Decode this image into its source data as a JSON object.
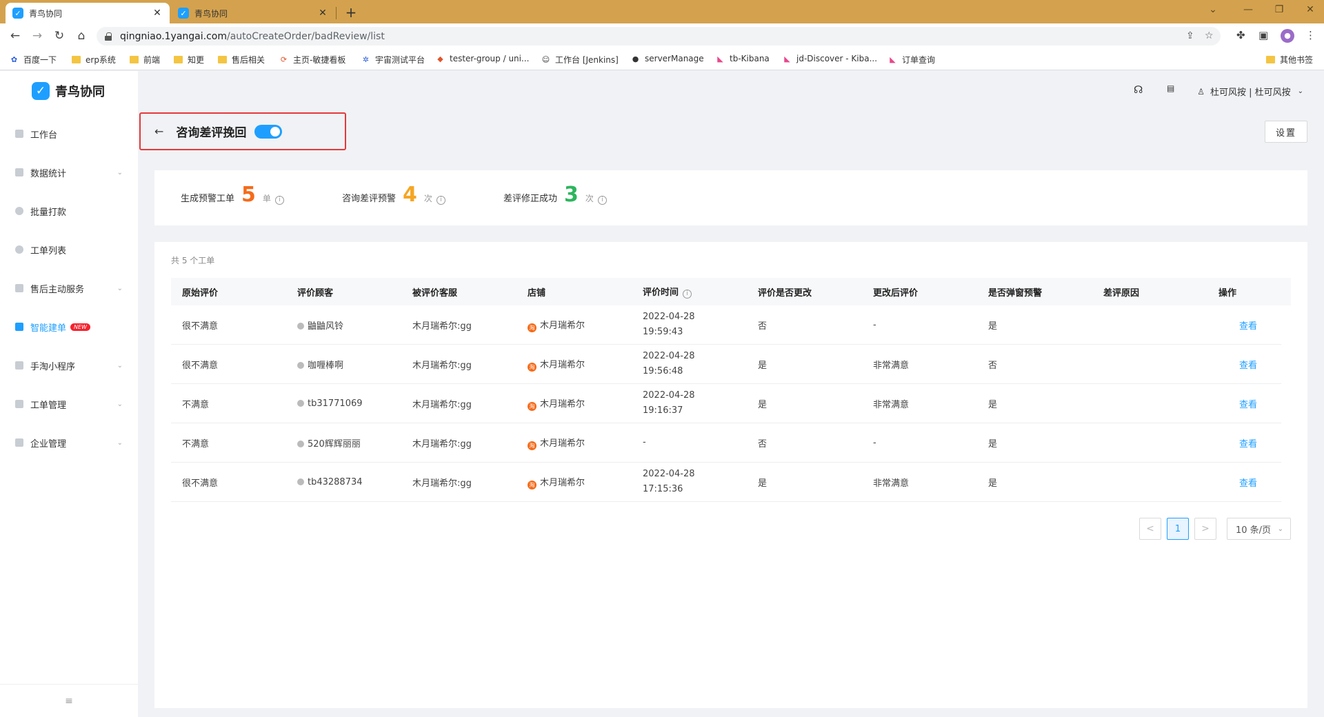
{
  "browser": {
    "tabs": [
      {
        "title": "青鸟协同",
        "favicon": "qingniao-favicon"
      },
      {
        "title": "青鸟协同",
        "favicon": "qingniao-favicon"
      }
    ],
    "new_tab": "+",
    "url_domain": "qingniao.1yangai.com",
    "url_path": "/autoCreateOrder/badReview/list",
    "bookmarks": [
      {
        "label": "百度一下",
        "icon": "baidu-icon"
      },
      {
        "label": "erp系统",
        "icon": "folder-icon"
      },
      {
        "label": "前端",
        "icon": "folder-icon"
      },
      {
        "label": "知更",
        "icon": "folder-icon"
      },
      {
        "label": "售后相关",
        "icon": "folder-icon"
      },
      {
        "label": "主页-敏捷看板",
        "icon": "agile-icon"
      },
      {
        "label": "宇宙测试平台",
        "icon": "gear-icon"
      },
      {
        "label": "tester-group / uni...",
        "icon": "gitlab-icon"
      },
      {
        "label": "工作台 [Jenkins]",
        "icon": "jenkins-icon"
      },
      {
        "label": "serverManage",
        "icon": "github-icon"
      },
      {
        "label": "tb-Kibana",
        "icon": "kibana-icon"
      },
      {
        "label": "jd-Discover - Kiba...",
        "icon": "kibana-icon"
      },
      {
        "label": "订单查询",
        "icon": "kibana-icon"
      }
    ],
    "other_bookmarks": "其他书签"
  },
  "app": {
    "logo_text": "青鸟协同",
    "sidebar": [
      {
        "label": "工作台",
        "has_chevron": false,
        "active": false
      },
      {
        "label": "数据统计",
        "has_chevron": true,
        "active": false
      },
      {
        "label": "批量打款",
        "has_chevron": false,
        "active": false
      },
      {
        "label": "工单列表",
        "has_chevron": false,
        "active": false
      },
      {
        "label": "售后主动服务",
        "has_chevron": true,
        "active": false
      },
      {
        "label": "智能建单",
        "has_chevron": false,
        "active": true,
        "badge": "NEW"
      },
      {
        "label": "手淘小程序",
        "has_chevron": true,
        "active": false
      },
      {
        "label": "工单管理",
        "has_chevron": true,
        "active": false
      },
      {
        "label": "企业管理",
        "has_chevron": true,
        "active": false
      }
    ],
    "collapse_icon": "≡",
    "header": {
      "user": "杜可风按 | 杜可风按"
    },
    "page": {
      "title": "咨询差评挽回",
      "toggle_on": true,
      "settings_label": "设置"
    },
    "stats": [
      {
        "label": "生成预警工单",
        "value": "5",
        "unit": "单",
        "color": "#f56b1a"
      },
      {
        "label": "咨询差评预警",
        "value": "4",
        "unit": "次",
        "color": "#f5a623"
      },
      {
        "label": "差评修正成功",
        "value": "3",
        "unit": "次",
        "color": "#2db55d"
      }
    ],
    "table": {
      "total_text": "共 5 个工单",
      "headers": [
        "原始评价",
        "评价顾客",
        "被评价客服",
        "店铺",
        "评价时间",
        "评价是否更改",
        "更改后评价",
        "是否弹窗预警",
        "差评原因",
        "操作"
      ],
      "rows": [
        {
          "original": "很不满意",
          "customer": "鼬鼬风铃",
          "agent": "木月瑞希尔:gg",
          "shop": "木月瑞希尔",
          "date": "2022-04-28",
          "time": "19:59:43",
          "changed": "否",
          "after": "-",
          "popup": "是",
          "reason": "",
          "action": "查看"
        },
        {
          "original": "很不满意",
          "customer": "咖喱棒啊",
          "agent": "木月瑞希尔:gg",
          "shop": "木月瑞希尔",
          "date": "2022-04-28",
          "time": "19:56:48",
          "changed": "是",
          "after": "非常满意",
          "popup": "否",
          "reason": "",
          "action": "查看"
        },
        {
          "original": "不满意",
          "customer": "tb31771069",
          "agent": "木月瑞希尔:gg",
          "shop": "木月瑞希尔",
          "date": "2022-04-28",
          "time": "19:16:37",
          "changed": "是",
          "after": "非常满意",
          "popup": "是",
          "reason": "",
          "action": "查看"
        },
        {
          "original": "不满意",
          "customer": "520辉辉丽丽",
          "agent": "木月瑞希尔:gg",
          "shop": "木月瑞希尔",
          "date": "-",
          "time": "",
          "changed": "否",
          "after": "-",
          "popup": "是",
          "reason": "",
          "action": "查看"
        },
        {
          "original": "很不满意",
          "customer": "tb43288734",
          "agent": "木月瑞希尔:gg",
          "shop": "木月瑞希尔",
          "date": "2022-04-28",
          "time": "17:15:36",
          "changed": "是",
          "after": "非常满意",
          "popup": "是",
          "reason": "",
          "action": "查看"
        }
      ]
    },
    "pagination": {
      "prev": "<",
      "current": "1",
      "next": ">",
      "page_size": "10 条/页"
    }
  }
}
